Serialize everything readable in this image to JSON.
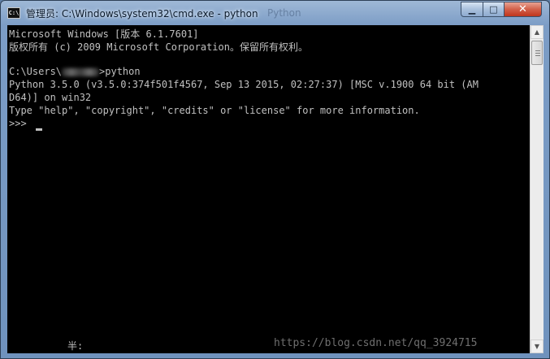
{
  "window": {
    "title": "管理员: C:\\Windows\\system32\\cmd.exe - python",
    "title_ghost": "Python",
    "app_icon_text": "C:\\"
  },
  "controls": {
    "minimize_icon": "minimize-icon",
    "maximize_icon": "maximize-icon",
    "close_icon": "close-icon"
  },
  "console": {
    "lines": [
      "Microsoft Windows [版本 6.1.7601]",
      "版权所有 (c) 2009 Microsoft Corporation。保留所有权利。",
      "",
      "C:\\Users\\",
      "Python 3.5.0 (v3.5.0:374f501f4567, Sep 13 2015, 02:27:37) [MSC v.1900 64 bit (AM",
      "D64)] on win32",
      "Type \"help\", \"copyright\", \"credits\" or \"license\" for more information.",
      ">>> "
    ],
    "prompt_command": ">python",
    "ime_status": "半:",
    "watermark": "https://blog.csdn.net/qq_3924715"
  },
  "colors": {
    "console_bg": "#000000",
    "console_fg": "#c0c0c0",
    "title_bar": "#7c9dc6",
    "close_button": "#c0361c"
  }
}
